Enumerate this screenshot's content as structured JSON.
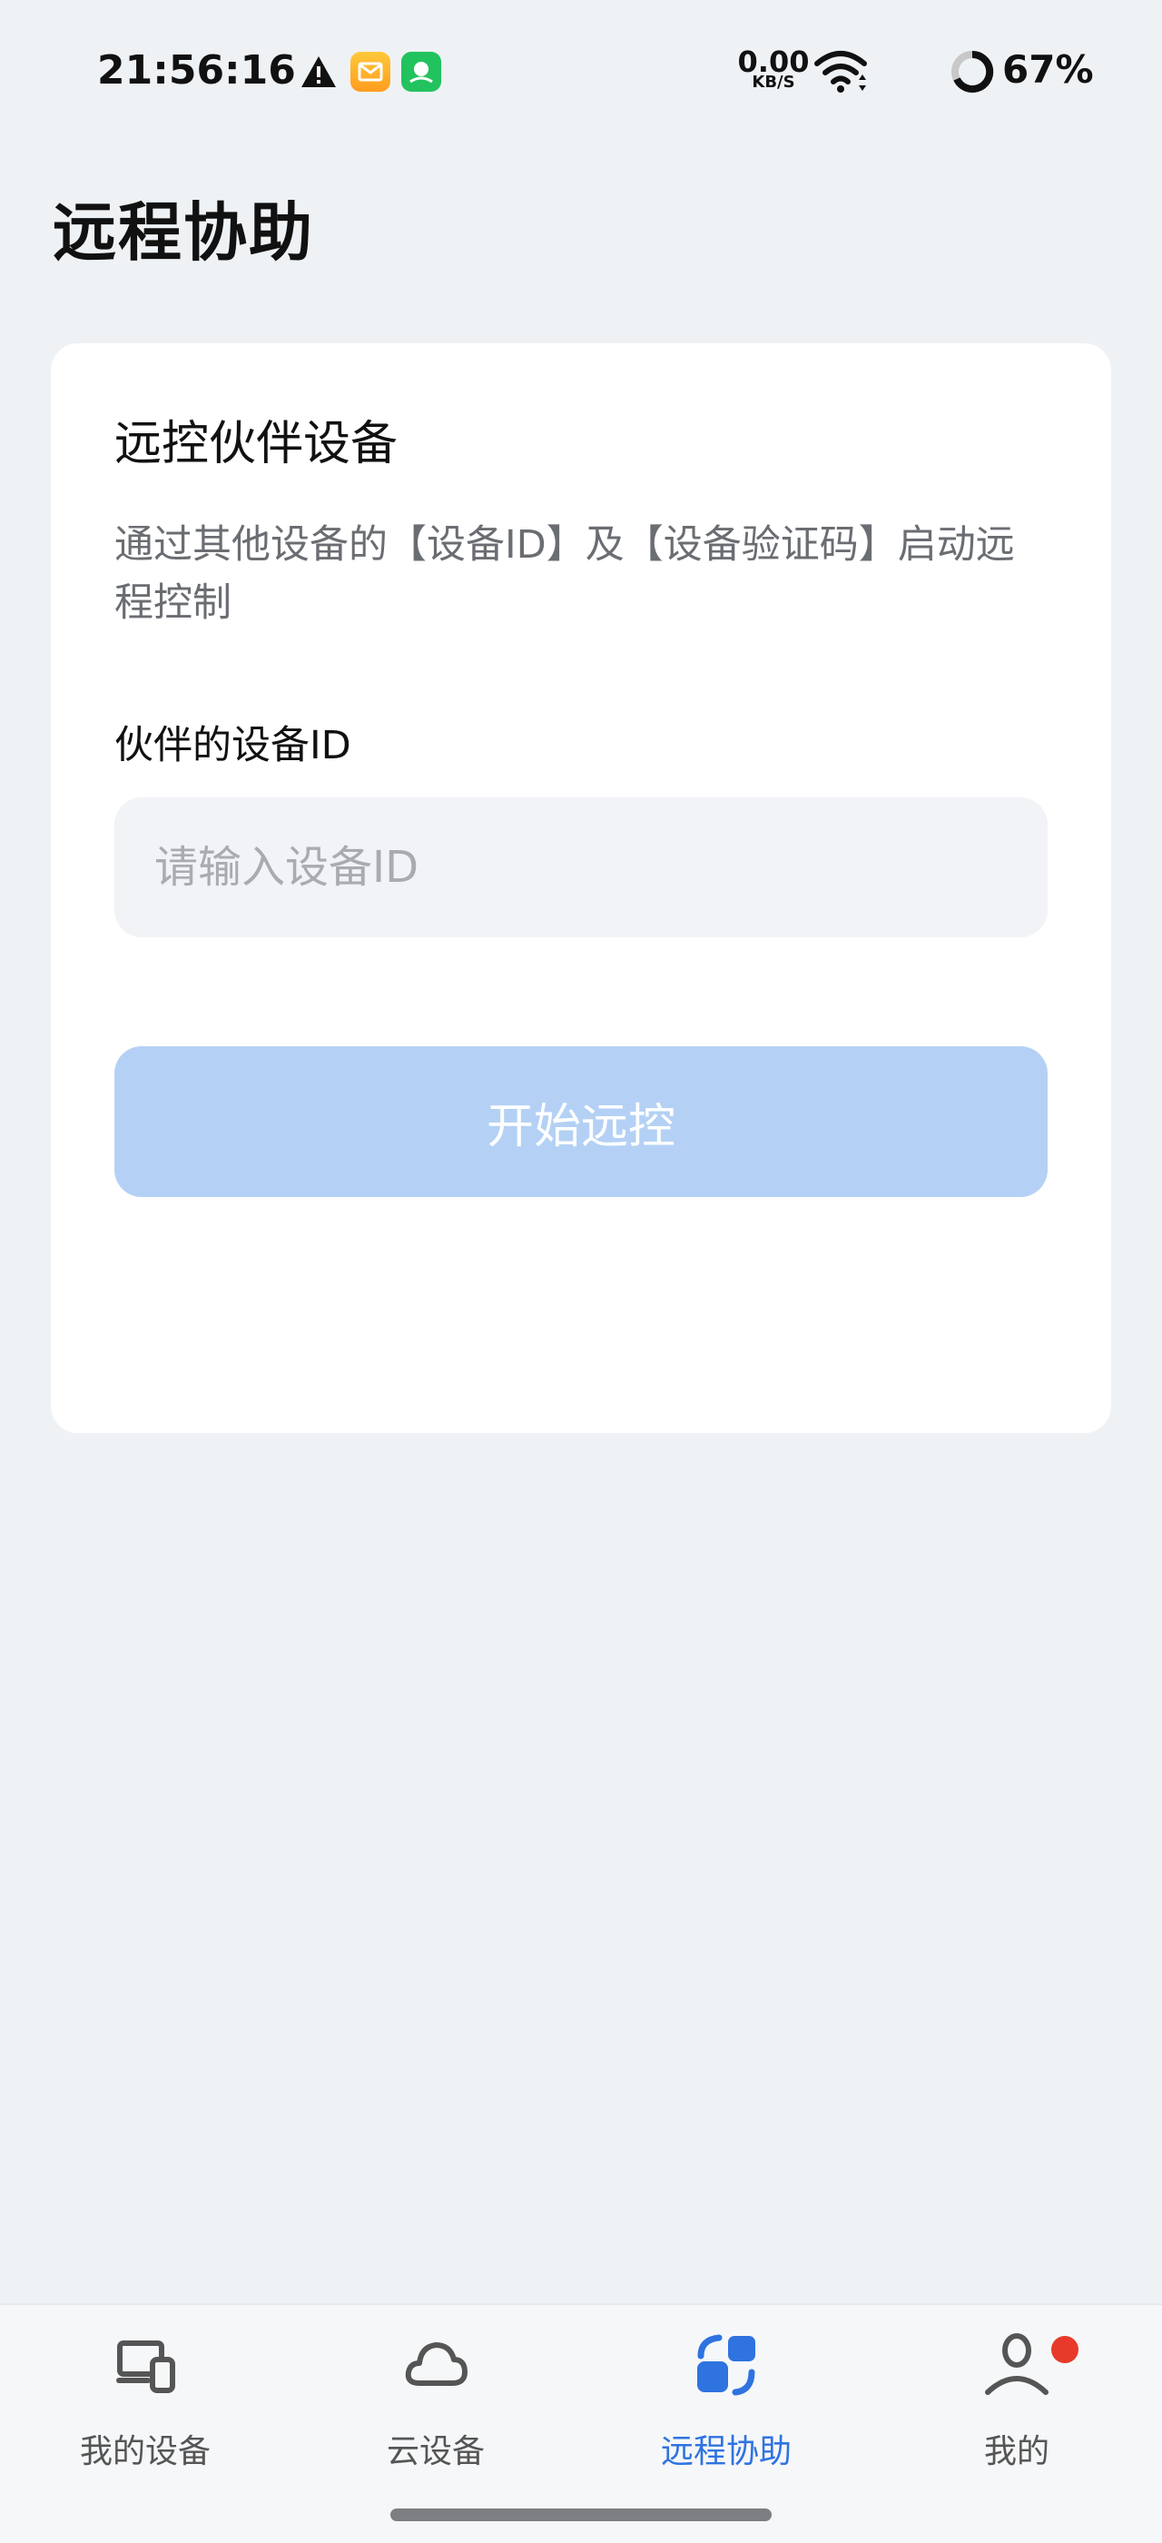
{
  "status_bar": {
    "time": "21:56:16",
    "net_speed_value": "0.00",
    "net_speed_unit": "KB/S",
    "battery": "67%"
  },
  "page": {
    "title": "远程协助"
  },
  "card": {
    "title": "远控伙伴设备",
    "description": "通过其他设备的【设备ID】及【设备验证码】启动远程控制",
    "field_label": "伙伴的设备ID",
    "input": {
      "placeholder": "请输入设备ID",
      "value": ""
    },
    "start_button_label": "开始远控"
  },
  "bottom_nav": {
    "items": [
      {
        "label": "我的设备",
        "icon": "devices-icon",
        "active": false
      },
      {
        "label": "云设备",
        "icon": "cloud-icon",
        "active": false
      },
      {
        "label": "远程协助",
        "icon": "remote-assist-icon",
        "active": true
      },
      {
        "label": "我的",
        "icon": "person-icon",
        "active": false,
        "badge": true
      }
    ]
  },
  "colors": {
    "accent": "#2f73e0",
    "button_disabled": "#b4d1f5",
    "background": "#eff2f5",
    "badge": "#e83a2a"
  }
}
